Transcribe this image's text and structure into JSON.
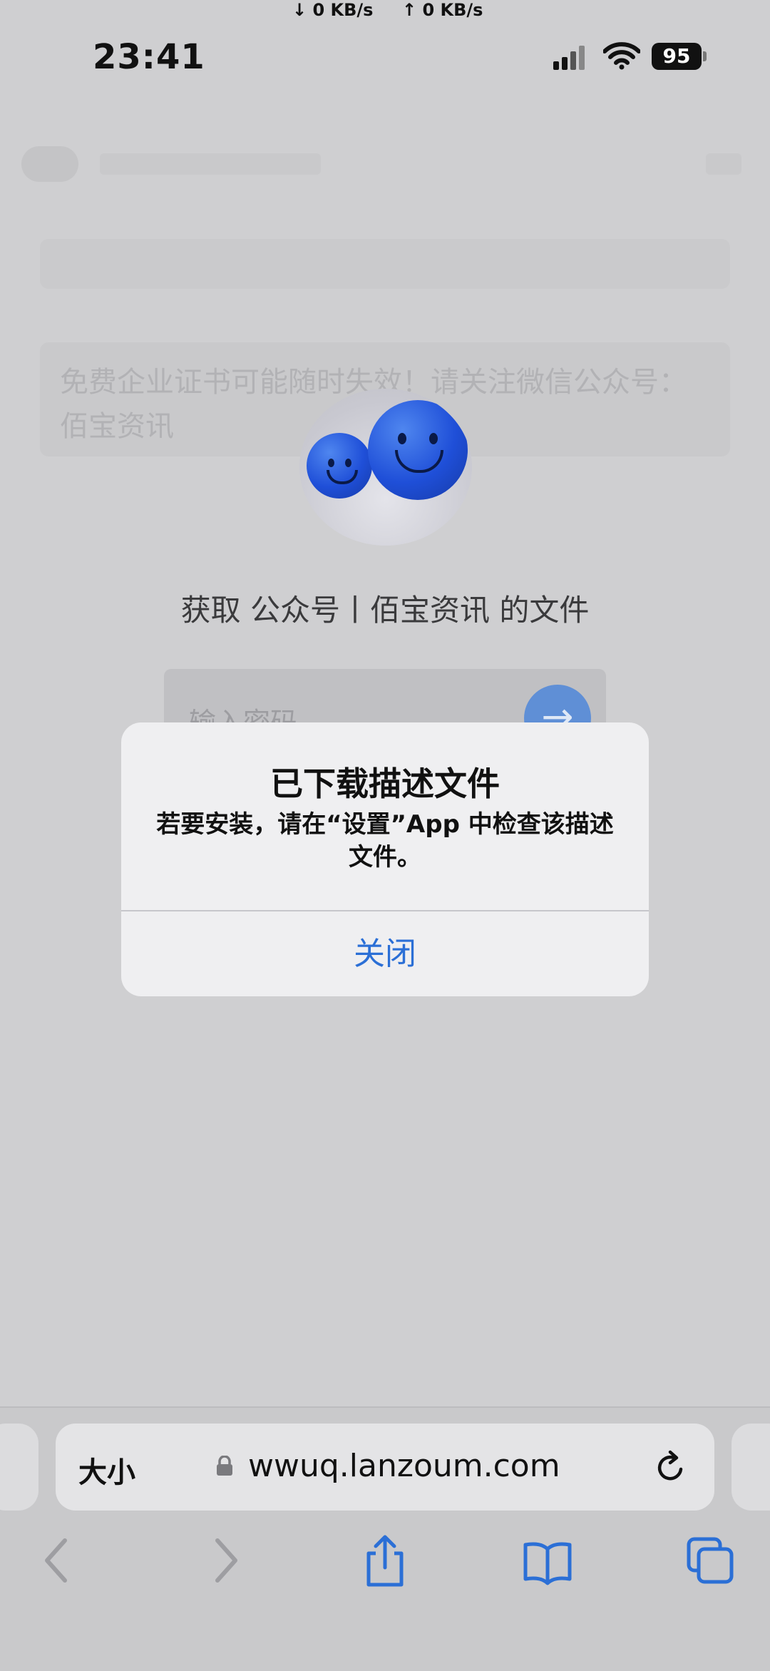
{
  "status_bar": {
    "download_speed": "↓ 0 KB/s",
    "upload_speed": "↑ 0 KB/s",
    "time": "23:41",
    "battery": "95"
  },
  "page": {
    "notice": "免费企业证书可能随时失效！请关注微信公众号：佰宝资讯",
    "get_file_title": "获取 公众号丨佰宝资讯 的文件",
    "password_placeholder": "输入密码",
    "submit_arrow": "→"
  },
  "alert": {
    "title": "已下载描述文件",
    "message": "若要安装，请在“设置”App 中检查该描述文件。",
    "close_label": "关闭"
  },
  "browser": {
    "text_size_label": "大小",
    "url": "wwuq.lanzoum.com"
  },
  "colors": {
    "accent": "#2b6fd6",
    "dim_background": "#cfcfd1",
    "ball_blue": "#1f4fd8"
  }
}
